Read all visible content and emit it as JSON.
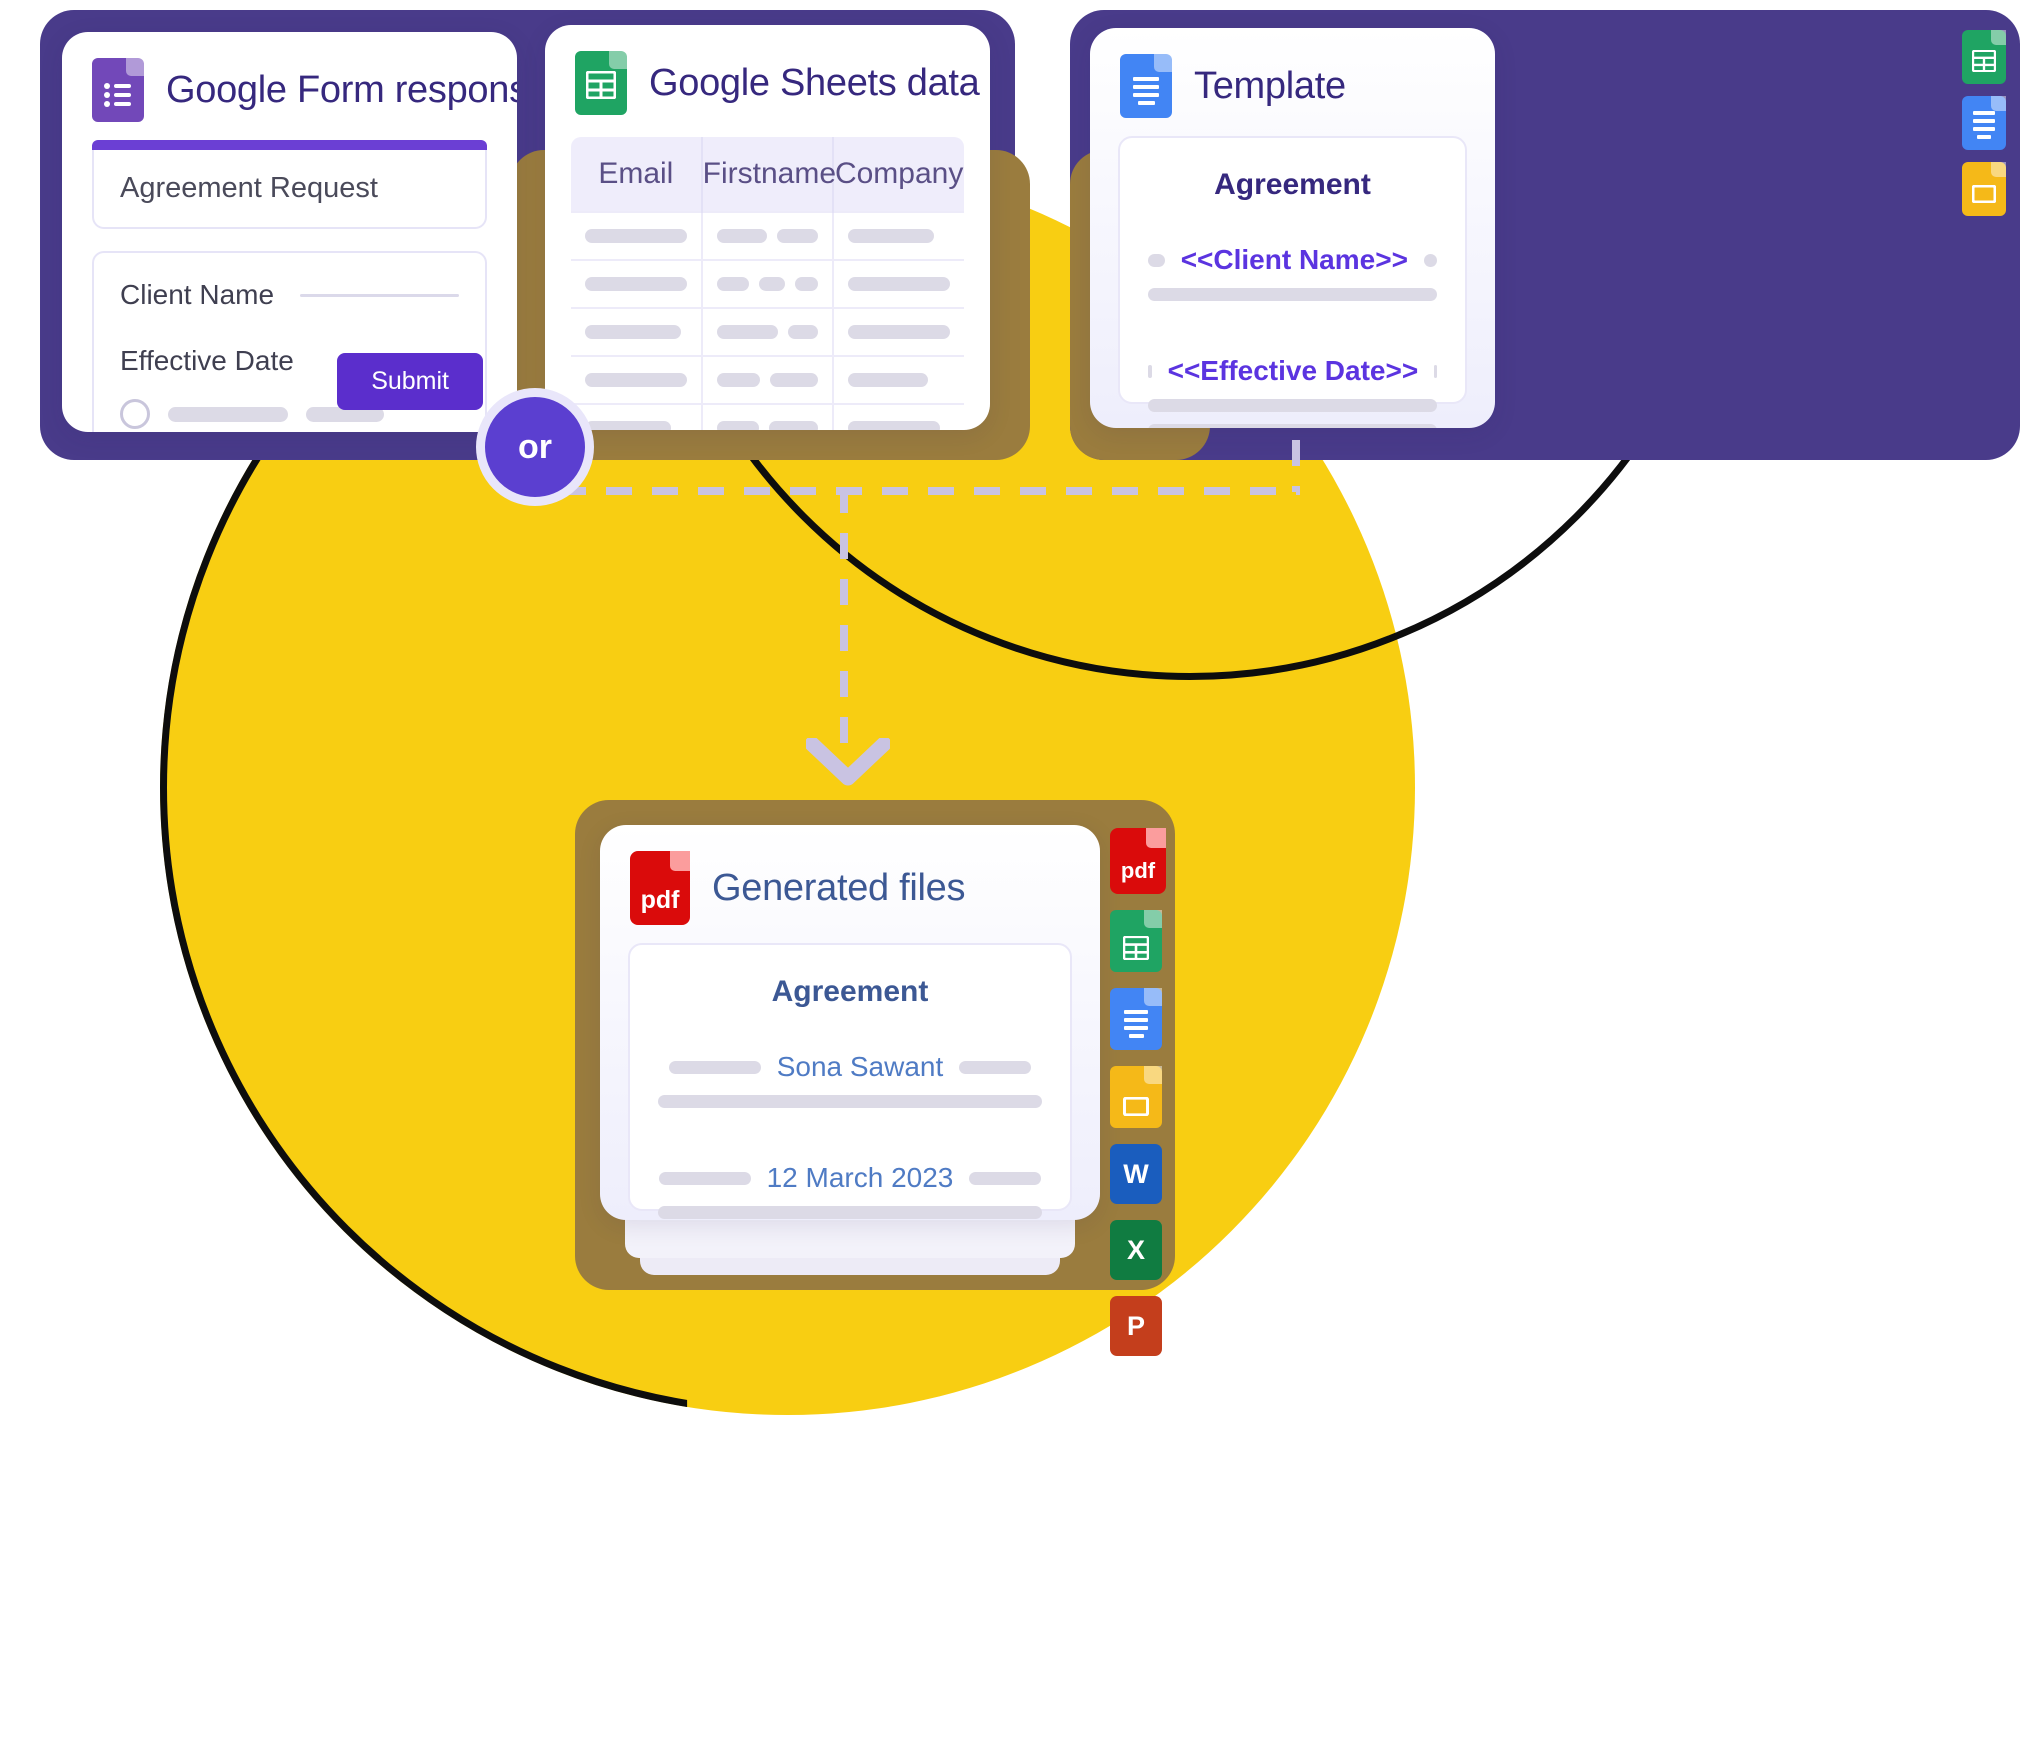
{
  "background": {
    "circle_color": "#F8CE12",
    "arc_color": "#0d0d0d"
  },
  "connector": {
    "or_label": "or",
    "or_badge_color": "#5B3FD0",
    "dash_color": "#C9C3E2"
  },
  "cards": {
    "form": {
      "title": "Google Form response",
      "icon": "google-forms-icon",
      "icon_color": "#7248B9",
      "accent_bar_color": "#6B3FD4",
      "form_title_value": "Agreement Request",
      "fields": [
        {
          "label": "Client Name"
        },
        {
          "label": "Effective Date"
        }
      ],
      "submit_label": "Submit",
      "submit_color": "#5B2ECC"
    },
    "sheets": {
      "title": "Google Sheets data",
      "icon": "google-sheets-icon",
      "icon_color": "#1FA463",
      "columns": [
        "Email",
        "Firstname",
        "Company"
      ],
      "row_count": 6
    },
    "template": {
      "title": "Template",
      "icon": "google-docs-icon",
      "icon_color": "#4285F4",
      "doc_title": "Agreement",
      "placeholders": [
        "<<Client Name>>",
        "<<Effective Date>>"
      ],
      "placeholder_color": "#5B34E0",
      "side_icons": [
        "google-sheets-icon",
        "google-docs-icon",
        "google-slides-icon"
      ]
    },
    "generated": {
      "title": "Generated files",
      "icon": "pdf-icon",
      "icon_color": "#DA0B0B",
      "icon_label": "pdf",
      "doc_title": "Agreement",
      "values": [
        "Sona Sawant",
        "12 March 2023"
      ],
      "value_color": "#4F7BC4",
      "side_icons": [
        {
          "name": "pdf-icon",
          "label": "pdf",
          "color": "#DA0B0B"
        },
        {
          "name": "google-sheets-icon",
          "label": "",
          "color": "#1FA463"
        },
        {
          "name": "google-docs-icon",
          "label": "",
          "color": "#4285F4"
        },
        {
          "name": "google-slides-icon",
          "label": "",
          "color": "#F5B918"
        },
        {
          "name": "word-icon",
          "label": "W",
          "color": "#1A5DBE"
        },
        {
          "name": "excel-icon",
          "label": "X",
          "color": "#107C41"
        },
        {
          "name": "powerpoint-icon",
          "label": "P",
          "color": "#C43E1C"
        }
      ]
    }
  }
}
